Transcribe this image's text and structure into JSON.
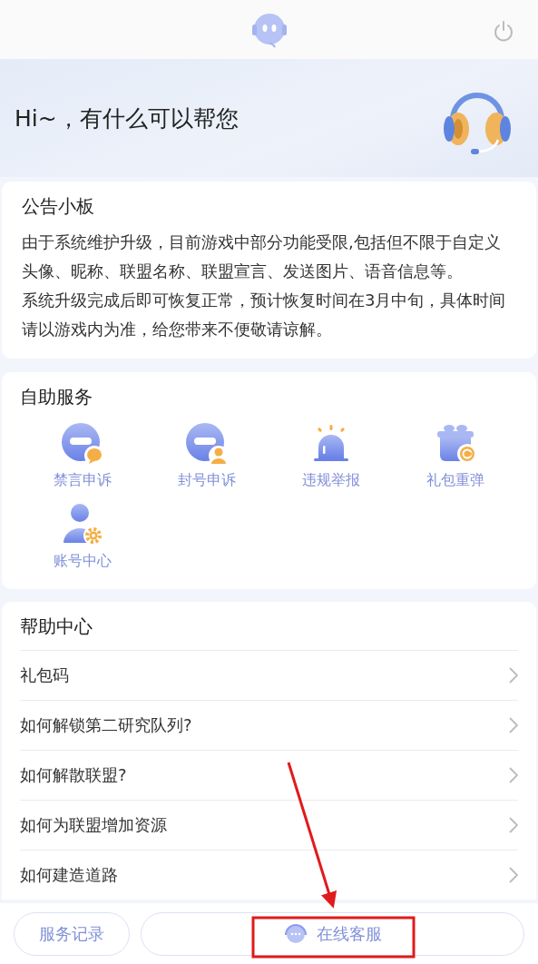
{
  "greeting": "Hi~，有什么可以帮您",
  "notice": {
    "title": "公告小板",
    "paragraphs": [
      "由于系统维护升级，目前游戏中部分功能受限,包括但不限于自定义头像、昵称、联盟名称、联盟宣言、发送图片、语音信息等。",
      "系统升级完成后即可恢复正常，预计恢复时间在3月中旬，具体时间请以游戏内为准，给您带来不便敬请谅解。"
    ]
  },
  "services": {
    "title": "自助服务",
    "items": [
      {
        "label": "禁言申诉",
        "kind": "chat"
      },
      {
        "label": "封号申诉",
        "kind": "user"
      },
      {
        "label": "违规举报",
        "kind": "siren"
      },
      {
        "label": "礼包重弹",
        "kind": "gift"
      },
      {
        "label": "账号中心",
        "kind": "account"
      }
    ]
  },
  "help": {
    "title": "帮助中心",
    "items": [
      "礼包码",
      "如何解锁第二研究队列?",
      "如何解散联盟?",
      "如何为联盟增加资源",
      "如何建造道路"
    ]
  },
  "bottom_bar": {
    "history_button": "服务记录",
    "chat_button": "在线客服"
  }
}
